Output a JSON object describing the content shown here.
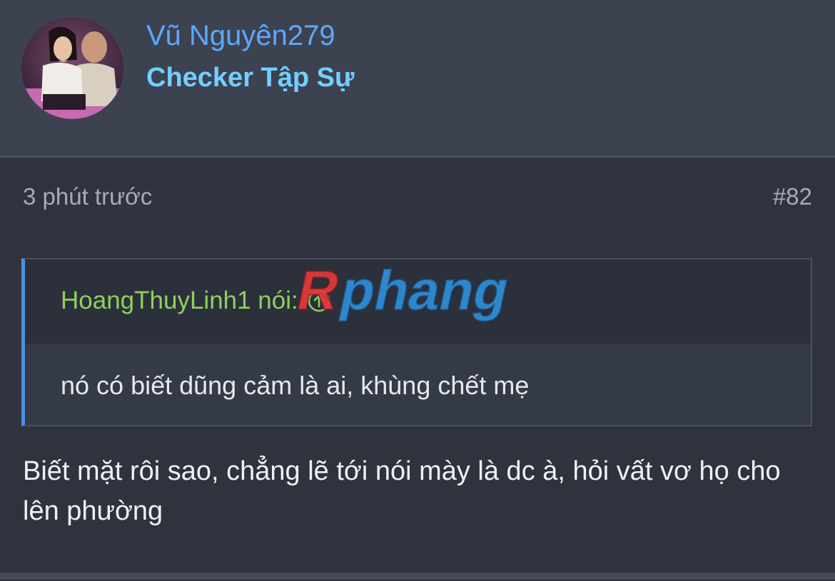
{
  "user": {
    "username": "Vũ Nguyên279",
    "title": "Checker Tập Sự"
  },
  "post": {
    "time": "3 phút trước",
    "number": "#82",
    "quote": {
      "author": "HoangThuyLinh1 nói:",
      "text": "nó có biết dũng cảm là ai, khùng chết mẹ"
    },
    "reply": "Biết mặt rôi sao, chẳng lẽ tới nói mày là dc à, hỏi vất vơ họ cho lên phường"
  },
  "watermark": {
    "text": "Rphang"
  },
  "colors": {
    "username": "#5aa9ff",
    "user_title": "#72cfff",
    "quote_author": "#8fcf5f",
    "quote_bar": "#4a90e2",
    "background": "#2f333e"
  }
}
